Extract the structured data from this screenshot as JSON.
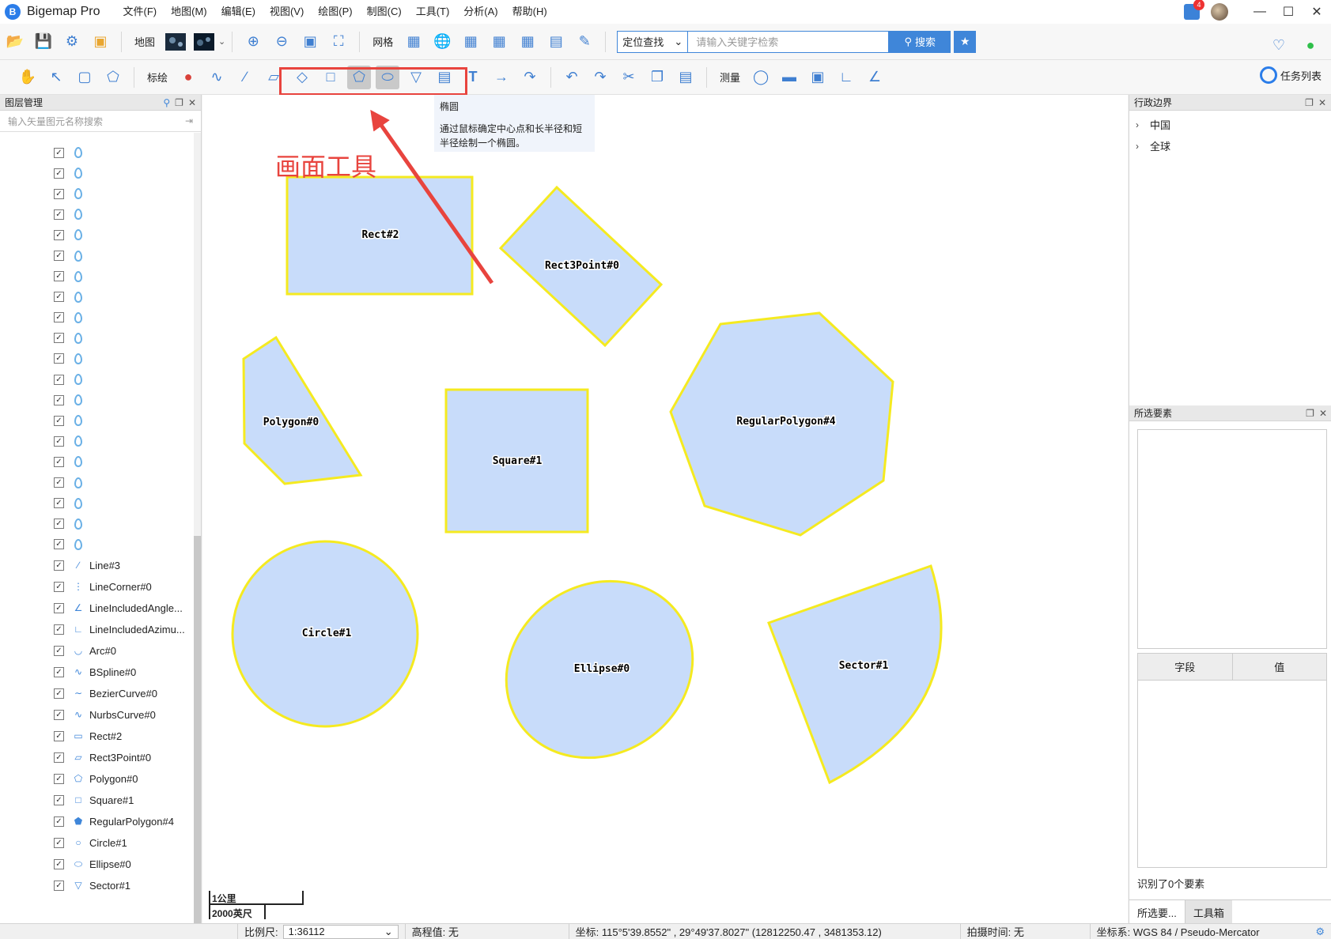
{
  "app": {
    "title": "Bigemap Pro"
  },
  "menu": [
    "文件(F)",
    "地图(M)",
    "编辑(E)",
    "视图(V)",
    "绘图(P)",
    "制图(C)",
    "工具(T)",
    "分析(A)",
    "帮助(H)"
  ],
  "notification_count": "4",
  "toolbar1": {
    "map_label": "地图",
    "grid_label": "网格",
    "locate_select": "定位查找",
    "search_placeholder": "请输入关键字检索",
    "search_button": "搜索"
  },
  "toolbar2": {
    "plot_label": "标绘",
    "measure_label": "测量",
    "task_list": "任务列表"
  },
  "left_panel": {
    "title": "图层管理",
    "search_placeholder": "输入矢量图元名称搜索",
    "named_layers": [
      {
        "name": "Line#3",
        "icon": "line-icon"
      },
      {
        "name": "LineCorner#0",
        "icon": "line-corner-icon"
      },
      {
        "name": "LineIncludedAngle...",
        "icon": "angle-icon"
      },
      {
        "name": "LineIncludedAzimu...",
        "icon": "azimuth-icon"
      },
      {
        "name": "Arc#0",
        "icon": "arc-icon"
      },
      {
        "name": "BSpline#0",
        "icon": "bspline-icon"
      },
      {
        "name": "BezierCurve#0",
        "icon": "bezier-icon"
      },
      {
        "name": "NurbsCurve#0",
        "icon": "nurbs-icon"
      },
      {
        "name": "Rect#2",
        "icon": "rect-icon"
      },
      {
        "name": "Rect3Point#0",
        "icon": "rect3point-icon"
      },
      {
        "name": "Polygon#0",
        "icon": "polygon-icon"
      },
      {
        "name": "Square#1",
        "icon": "square-icon"
      },
      {
        "name": "RegularPolygon#4",
        "icon": "regular-polygon-icon"
      },
      {
        "name": "Circle#1",
        "icon": "circle-icon"
      },
      {
        "name": "Ellipse#0",
        "icon": "ellipse-icon"
      },
      {
        "name": "Sector#1",
        "icon": "sector-icon"
      }
    ]
  },
  "map": {
    "annotation": "画面工具",
    "tooltip": {
      "title": "椭圆",
      "body": "通过鼠标确定中心点和长半径和短半径绘制一个椭圆。"
    },
    "shapes": {
      "rect": "Rect#2",
      "rect3point": "Rect3Point#0",
      "polygon": "Polygon#0",
      "square": "Square#1",
      "regular_polygon": "RegularPolygon#4",
      "circle": "Circle#1",
      "ellipse": "Ellipse#0",
      "sector": "Sector#1"
    },
    "scale": {
      "metric": "1公里",
      "imperial": "2000英尺"
    },
    "colors": {
      "fill": "#c8dcfa",
      "stroke": "#f5ea20",
      "annotation": "#e8443e"
    }
  },
  "right_panel": {
    "admin_title": "行政边界",
    "admin_items": [
      "中国",
      "全球"
    ],
    "selected_title": "所选要素",
    "field_col": "字段",
    "value_col": "值",
    "recognized": "识别了0个要素",
    "tabs": [
      "所选要...",
      "工具箱"
    ]
  },
  "status": {
    "scale_label": "比例尺:",
    "scale_value": "1:36112",
    "elevation": "高程值: 无",
    "coords": "坐标: 115°5'39.8552\" , 29°49'37.8027\"  (12812250.47 , 3481353.12)",
    "capture_time": "拍摄时间: 无",
    "crs": "坐标系: WGS 84 / Pseudo-Mercator"
  }
}
